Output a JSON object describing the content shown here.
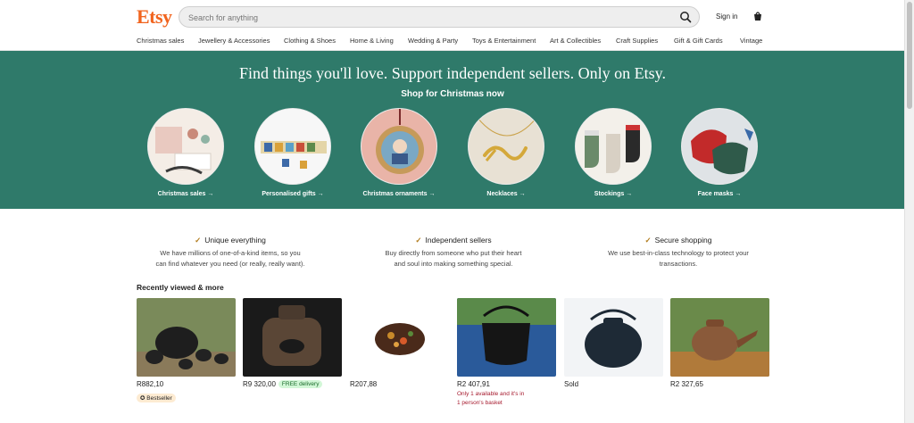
{
  "header": {
    "logo": "Etsy",
    "search_placeholder": "Search for anything",
    "signin": "Sign in"
  },
  "categories": [
    "Christmas sales",
    "Jewellery & Accessories",
    "Clothing & Shoes",
    "Home & Living",
    "Wedding & Party",
    "Toys & Entertainment",
    "Art & Collectibles",
    "Craft Supplies",
    "Gift & Gift Cards",
    "Vintage"
  ],
  "hero": {
    "title": "Find things you'll love. Support independent sellers. Only on Etsy.",
    "subtitle": "Shop for Christmas now",
    "items": [
      {
        "label": "Christmas sales →"
      },
      {
        "label": "Personalised gifts →"
      },
      {
        "label": "Christmas ornaments →"
      },
      {
        "label": "Necklaces →"
      },
      {
        "label": "Stockings →"
      },
      {
        "label": "Face masks →"
      }
    ]
  },
  "value_props": [
    {
      "heading": "Unique everything",
      "line1": "We have millions of one-of-a-kind items, so you",
      "line2": "can find whatever you need (or really, really want)."
    },
    {
      "heading": "Independent sellers",
      "line1": "Buy directly from someone who put their heart",
      "line2": "and soul into making something special."
    },
    {
      "heading": "Secure shopping",
      "line1": "We use best-in-class technology to protect your",
      "line2": "transactions."
    }
  ],
  "recent": {
    "title": "Recently viewed & more",
    "items": [
      {
        "price": "R882,10",
        "badge": "Bestseller"
      },
      {
        "price": "R9 320,00",
        "badge": "FREE delivery"
      },
      {
        "price": "R207,88"
      },
      {
        "price": "R2 407,91",
        "note1": "Only 1 available and it's in",
        "note2": "1 person's basket"
      },
      {
        "price": "Sold"
      },
      {
        "price": "R2 327,65"
      }
    ]
  },
  "colors": {
    "brand": "#F1641E",
    "hero": "#2f7a6a"
  }
}
